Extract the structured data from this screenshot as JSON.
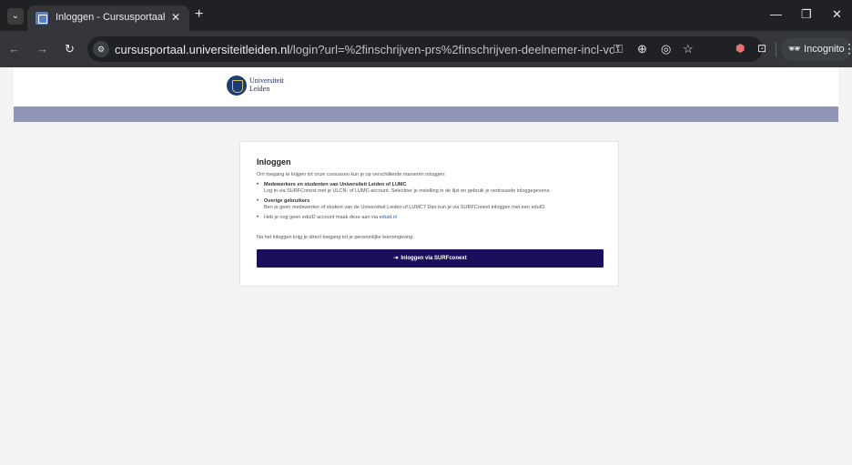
{
  "browser": {
    "tab_title": "Inloggen - Cursusportaal",
    "url_host": "cursusportaal.universiteitleiden.nl",
    "url_path": "/login?url=%2finschrijven-prs%2finschrijven-deelnemer-incl-voorwaarden%3fKnCrel...",
    "incognito_label": "Incognito"
  },
  "header": {
    "logo_line1": "Universiteit",
    "logo_line2": "Leiden"
  },
  "login_card": {
    "title": "Inloggen",
    "intro": "Om toegang te krijgen tot onze cursussen kun je op verschillende manieren inloggen:",
    "items": [
      {
        "title": "Medewerkers en studenten van Universiteit Leiden of LUMC",
        "text": "Log in via SURFConext met je ULCN- of LUMC-account. Selecteer je instelling in de lijst en gebruik je vertrouwde inloggegevens."
      },
      {
        "title": "Overige gebruikers",
        "text": "Ben je geen medewerker of student van de Universiteit Leiden of LUMC? Dan kun je via SURFConext inloggen met een eduID."
      },
      {
        "text": "Heb je nog geen eduID account maak deze aan via",
        "link": "eduid.nl"
      }
    ],
    "outro": "Na het inloggen krijg je direct toegang tot je persoonlijke leeromgeving.",
    "button_label": "Inloggen via SURFconext"
  }
}
